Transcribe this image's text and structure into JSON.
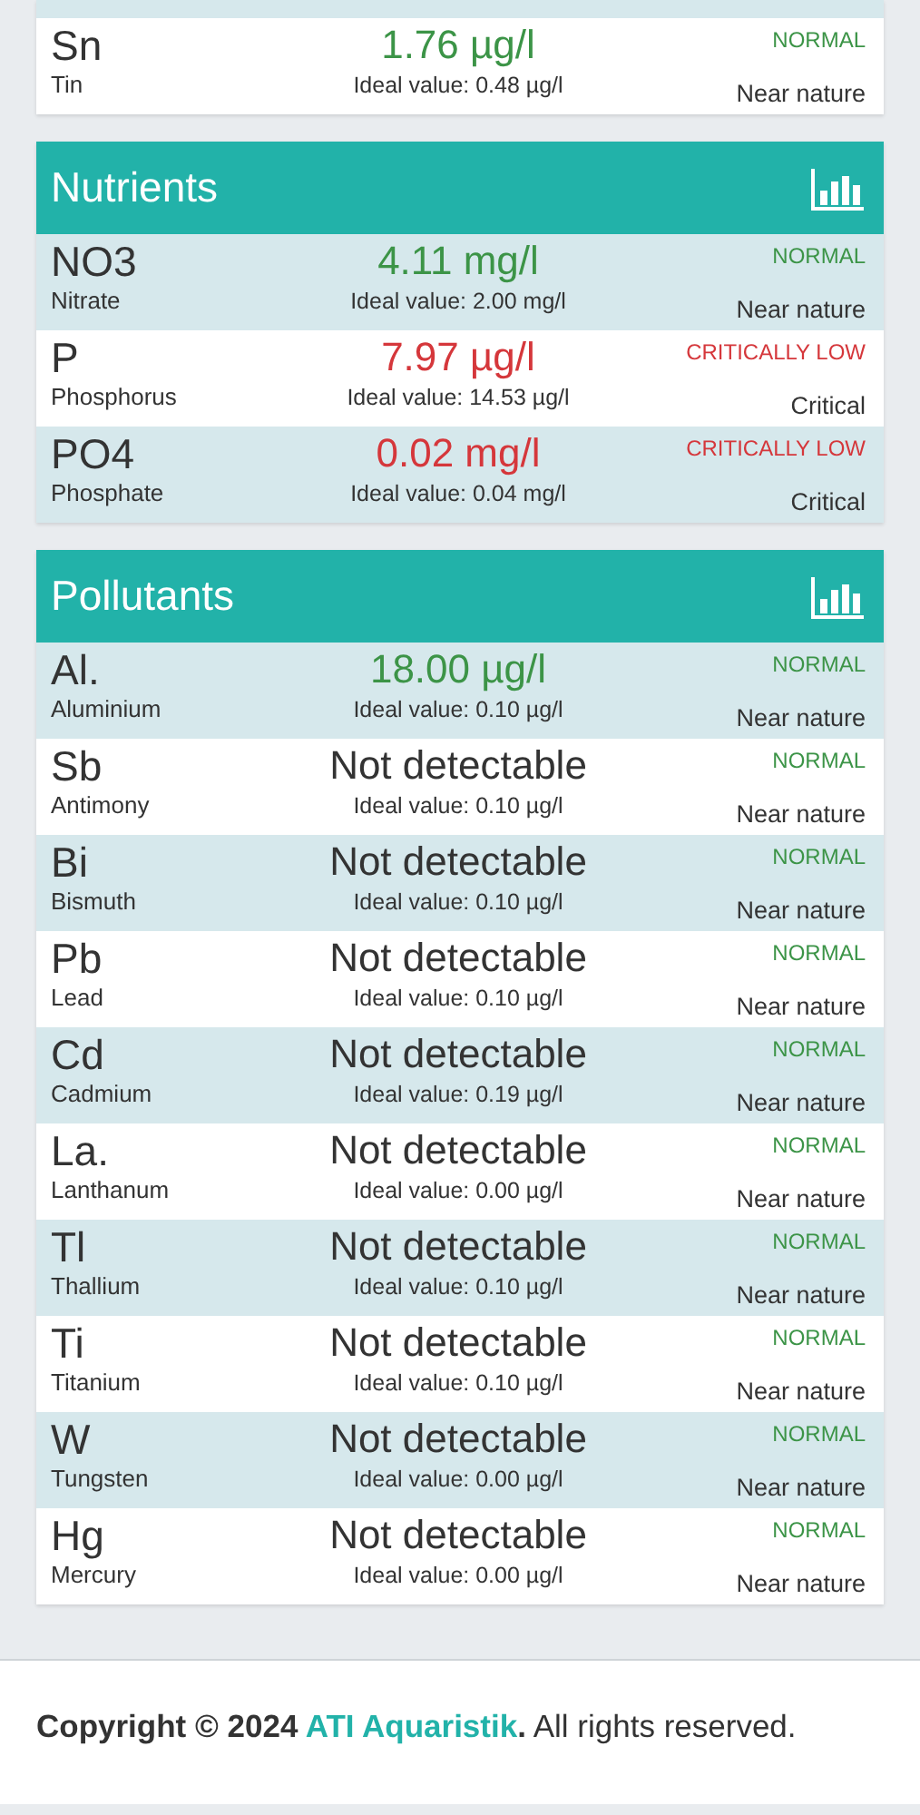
{
  "top_card": {
    "rows": [
      {
        "symbol": "Sn",
        "name": "Tin",
        "value": "1.76 µg/l",
        "detected": true,
        "critical": false,
        "ideal": "Ideal value: 0.48 µg/l",
        "status": "NORMAL",
        "assessment": "Near nature"
      }
    ]
  },
  "sections": [
    {
      "title": "Nutrients",
      "rows": [
        {
          "symbol": "NO3",
          "name": "Nitrate",
          "value": "4.11 mg/l",
          "detected": true,
          "critical": false,
          "ideal": "Ideal value: 2.00 mg/l",
          "status": "NORMAL",
          "assessment": "Near nature"
        },
        {
          "symbol": "P",
          "name": "Phosphorus",
          "value": "7.97 µg/l",
          "detected": true,
          "critical": true,
          "ideal": "Ideal value: 14.53 µg/l",
          "status": "CRITICALLY LOW",
          "assessment": "Critical"
        },
        {
          "symbol": "PO4",
          "name": "Phosphate",
          "value": "0.02 mg/l",
          "detected": true,
          "critical": true,
          "ideal": "Ideal value: 0.04 mg/l",
          "status": "CRITICALLY LOW",
          "assessment": "Critical"
        }
      ]
    },
    {
      "title": "Pollutants",
      "rows": [
        {
          "symbol": "Al.",
          "name": "Aluminium",
          "value": "18.00 µg/l",
          "detected": true,
          "critical": false,
          "ideal": "Ideal value: 0.10 µg/l",
          "status": "NORMAL",
          "assessment": "Near nature"
        },
        {
          "symbol": "Sb",
          "name": "Antimony",
          "value": "Not detectable",
          "detected": false,
          "critical": false,
          "ideal": "Ideal value: 0.10 µg/l",
          "status": "NORMAL",
          "assessment": "Near nature"
        },
        {
          "symbol": "Bi",
          "name": "Bismuth",
          "value": "Not detectable",
          "detected": false,
          "critical": false,
          "ideal": "Ideal value: 0.10 µg/l",
          "status": "NORMAL",
          "assessment": "Near nature"
        },
        {
          "symbol": "Pb",
          "name": "Lead",
          "value": "Not detectable",
          "detected": false,
          "critical": false,
          "ideal": "Ideal value: 0.10 µg/l",
          "status": "NORMAL",
          "assessment": "Near nature"
        },
        {
          "symbol": "Cd",
          "name": "Cadmium",
          "value": "Not detectable",
          "detected": false,
          "critical": false,
          "ideal": "Ideal value: 0.19 µg/l",
          "status": "NORMAL",
          "assessment": "Near nature"
        },
        {
          "symbol": "La.",
          "name": "Lanthanum",
          "value": "Not detectable",
          "detected": false,
          "critical": false,
          "ideal": "Ideal value: 0.00 µg/l",
          "status": "NORMAL",
          "assessment": "Near nature"
        },
        {
          "symbol": "Tl",
          "name": "Thallium",
          "value": "Not detectable",
          "detected": false,
          "critical": false,
          "ideal": "Ideal value: 0.10 µg/l",
          "status": "NORMAL",
          "assessment": "Near nature"
        },
        {
          "symbol": "Ti",
          "name": "Titanium",
          "value": "Not detectable",
          "detected": false,
          "critical": false,
          "ideal": "Ideal value: 0.10 µg/l",
          "status": "NORMAL",
          "assessment": "Near nature"
        },
        {
          "symbol": "W",
          "name": "Tungsten",
          "value": "Not detectable",
          "detected": false,
          "critical": false,
          "ideal": "Ideal value: 0.00 µg/l",
          "status": "NORMAL",
          "assessment": "Near nature"
        },
        {
          "symbol": "Hg",
          "name": "Mercury",
          "value": "Not detectable",
          "detected": false,
          "critical": false,
          "ideal": "Ideal value: 0.00 µg/l",
          "status": "NORMAL",
          "assessment": "Near nature"
        }
      ]
    }
  ],
  "footer": {
    "copyright": "Copyright © 2024",
    "brand": "ATI Aquaristik",
    "period": ".",
    "rights": "All rights reserved."
  }
}
